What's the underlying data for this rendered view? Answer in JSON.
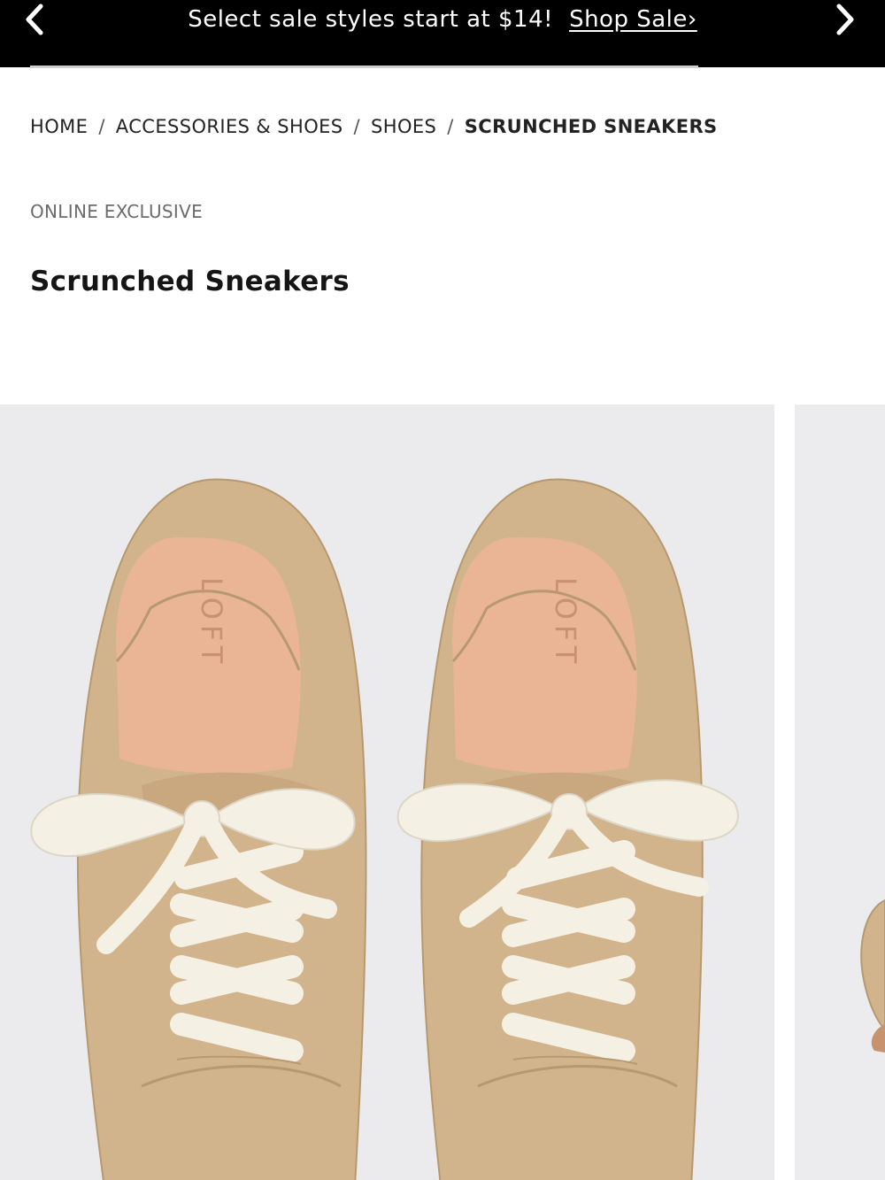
{
  "promo": {
    "message": "Select sale styles start at $14!",
    "link_label": "Shop Sale›",
    "prev_icon": "chevron-left-icon",
    "next_icon": "chevron-right-icon"
  },
  "breadcrumb": {
    "items": [
      "HOME",
      "ACCESSORIES & SHOES",
      "SHOES",
      "SCRUNCHED SNEAKERS"
    ],
    "separator": "/"
  },
  "product": {
    "badge": "ONLINE EXCLUSIVE",
    "title": "Scrunched Sneakers",
    "insole_brand": "LOFT",
    "colors": {
      "suede": "#d2b48c",
      "insole": "#e9b594",
      "laces": "#f4f0e4",
      "background": "#ebebed"
    }
  }
}
